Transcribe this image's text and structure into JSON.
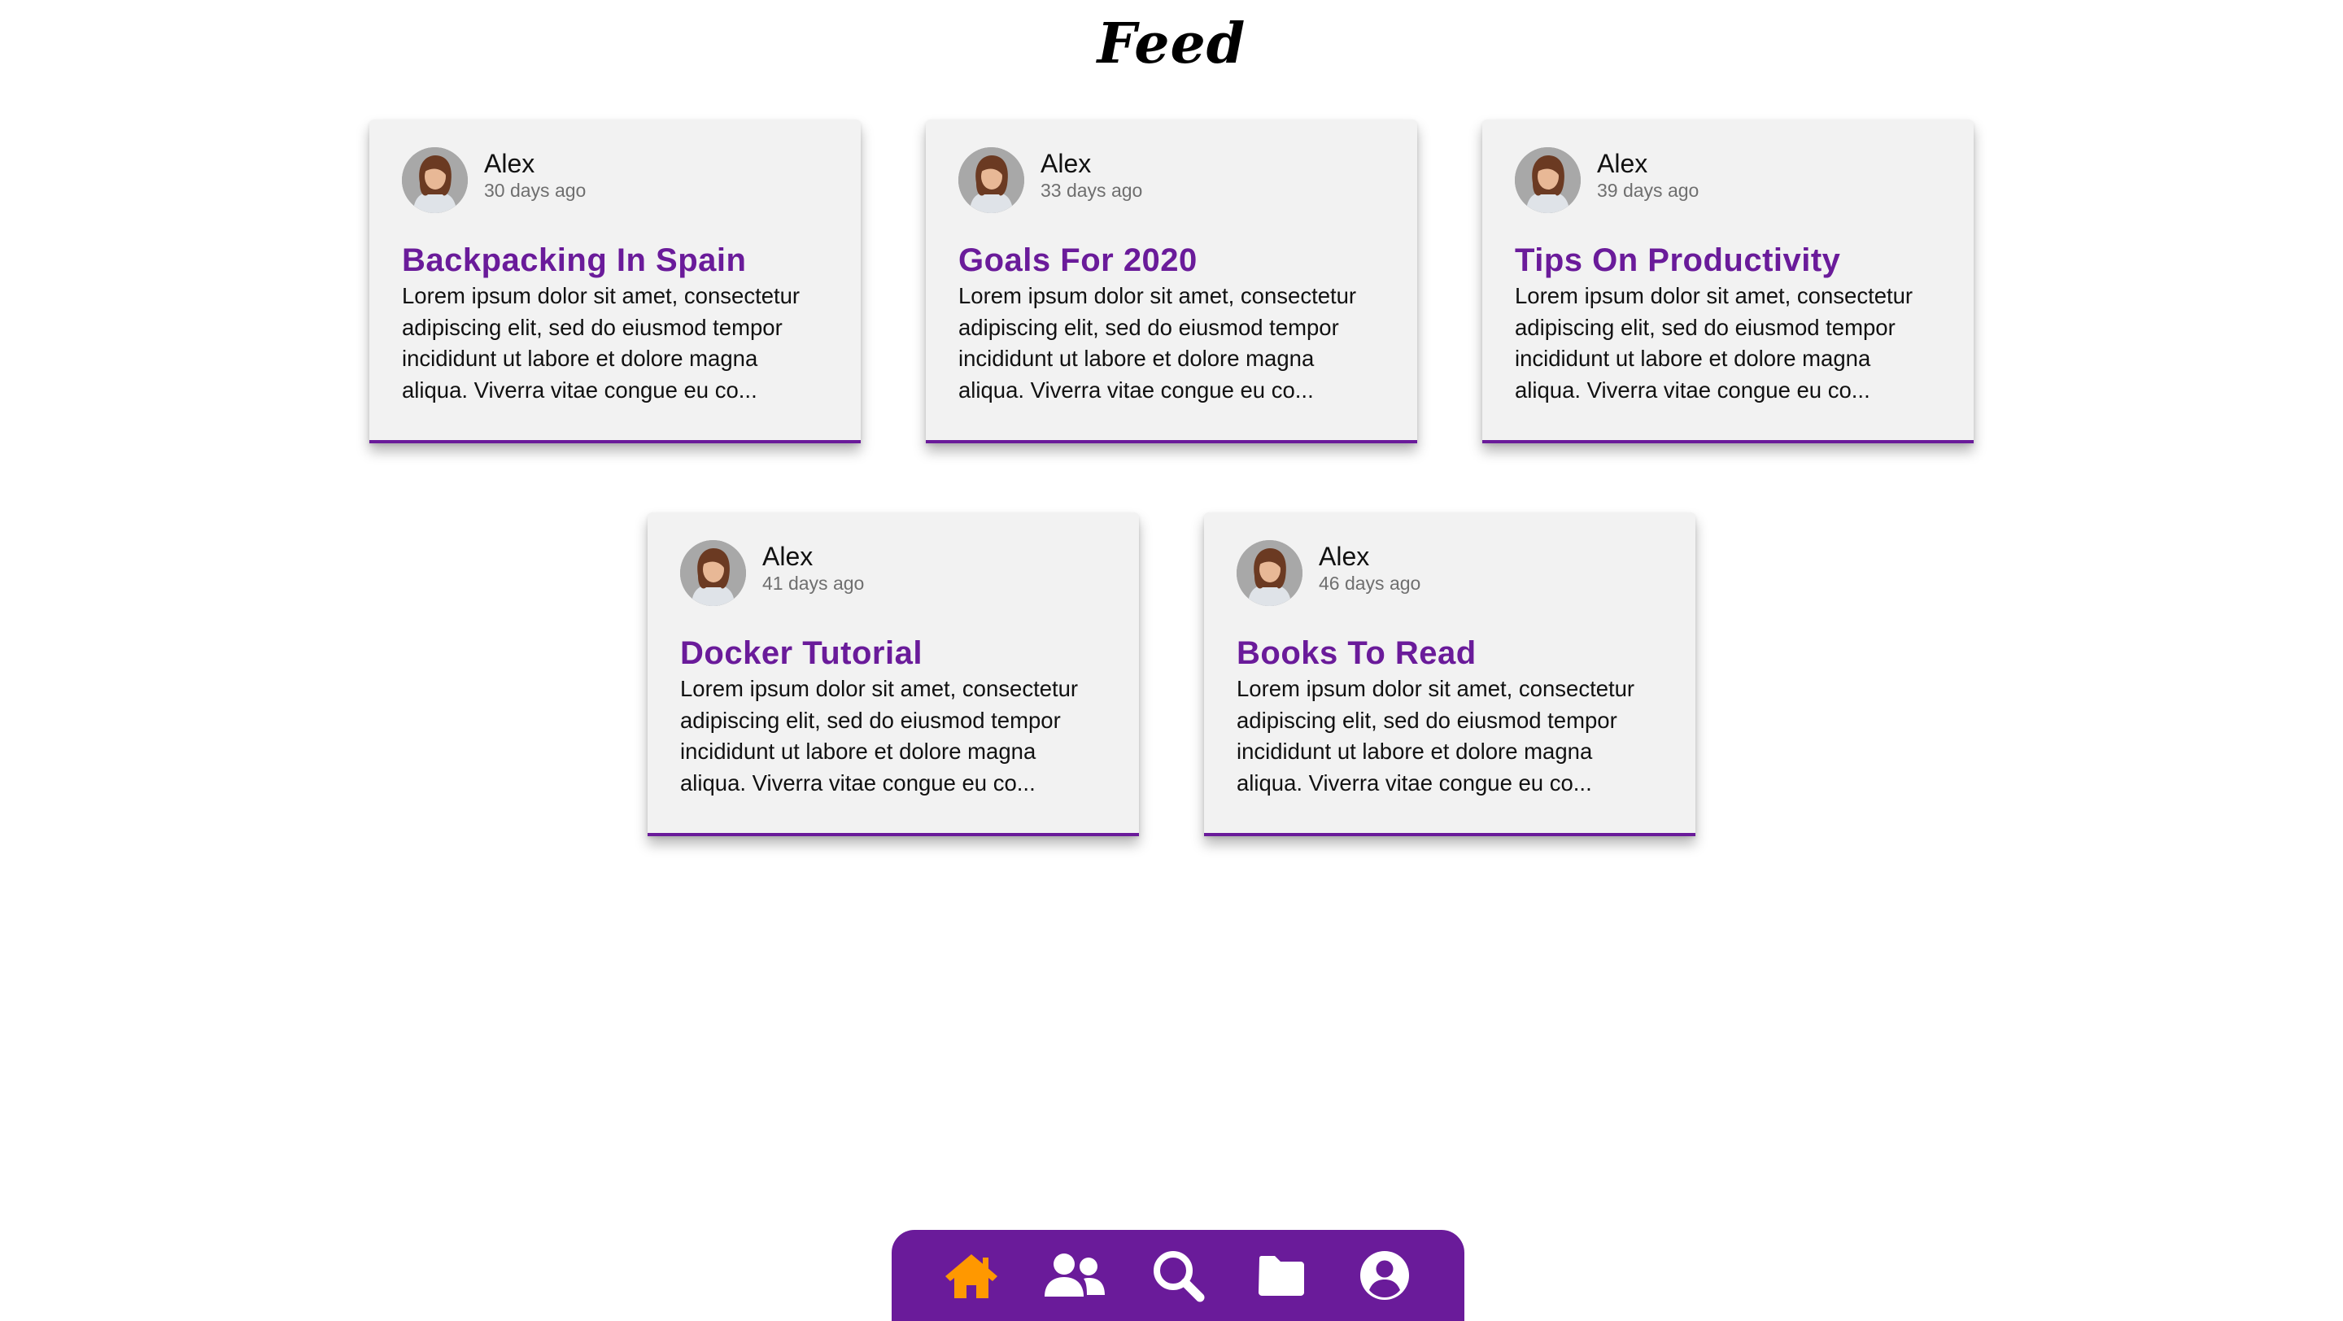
{
  "page": {
    "title": "Feed"
  },
  "theme": {
    "accent": "#6a1b9a",
    "active_nav": "#ff9800",
    "nav_icon": "#ffffff",
    "card_bg": "#f2f2f2"
  },
  "posts": [
    {
      "author": "Alex",
      "time": "30 days ago",
      "title": "Backpacking In Spain",
      "excerpt": "Lorem ipsum dolor sit amet, consectetur adipiscing elit, sed do eiusmod tempor incididunt ut labore et dolore magna aliqua. Viverra vitae congue eu co..."
    },
    {
      "author": "Alex",
      "time": "33 days ago",
      "title": "Goals For 2020",
      "excerpt": "Lorem ipsum dolor sit amet, consectetur adipiscing elit, sed do eiusmod tempor incididunt ut labore et dolore magna aliqua. Viverra vitae congue eu co..."
    },
    {
      "author": "Alex",
      "time": "39 days ago",
      "title": "Tips On Productivity",
      "excerpt": "Lorem ipsum dolor sit amet, consectetur adipiscing elit, sed do eiusmod tempor incididunt ut labore et dolore magna aliqua. Viverra vitae congue eu co..."
    },
    {
      "author": "Alex",
      "time": "41 days ago",
      "title": "Docker Tutorial",
      "excerpt": "Lorem ipsum dolor sit amet, consectetur adipiscing elit, sed do eiusmod tempor incididunt ut labore et dolore magna aliqua. Viverra vitae congue eu co..."
    },
    {
      "author": "Alex",
      "time": "46 days ago",
      "title": "Books To Read",
      "excerpt": "Lorem ipsum dolor sit amet, consectetur adipiscing elit, sed do eiusmod tempor incididunt ut labore et dolore magna aliqua. Viverra vitae congue eu co..."
    }
  ],
  "nav": {
    "items": [
      {
        "icon": "home-icon",
        "active": true
      },
      {
        "icon": "users-icon",
        "active": false
      },
      {
        "icon": "search-icon",
        "active": false
      },
      {
        "icon": "folder-icon",
        "active": false
      },
      {
        "icon": "user-circle-icon",
        "active": false
      }
    ]
  }
}
